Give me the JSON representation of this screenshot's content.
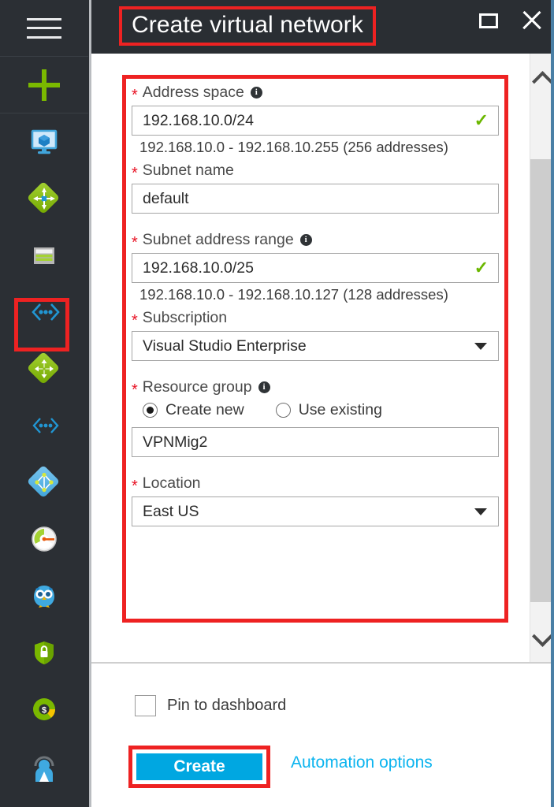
{
  "window": {
    "title": "Create virtual network",
    "restore_label": "restore-window",
    "close_label": "close-window"
  },
  "colors": {
    "accent_blue": "#00a7e1",
    "link_blue": "#0cb4ef",
    "annotation_red": "#ee2222",
    "required_red": "#e81123",
    "valid_green": "#6bb700",
    "sidebar_bg": "#2b2f34",
    "header_bg": "#2a2e33"
  },
  "sidebar": {
    "items": [
      {
        "name": "menu-hamburger",
        "icon": "hamburger-icon"
      },
      {
        "name": "create-resource",
        "icon": "plus-icon"
      },
      {
        "name": "dashboard",
        "icon": "dashboard-monitor-icon"
      },
      {
        "name": "all-resources",
        "icon": "all-resources-icon"
      },
      {
        "name": "resource-groups",
        "icon": "resource-groups-icon"
      },
      {
        "name": "virtual-networks-selected",
        "icon": "virtual-network-icon"
      },
      {
        "name": "load-balancers",
        "icon": "load-balancer-icon"
      },
      {
        "name": "virtual-networks",
        "icon": "virtual-network-icon"
      },
      {
        "name": "azure-active-directory",
        "icon": "azure-ad-icon"
      },
      {
        "name": "monitor",
        "icon": "monitor-gauge-icon"
      },
      {
        "name": "advisor",
        "icon": "owl-advisor-icon"
      },
      {
        "name": "security-center",
        "icon": "shield-lock-icon"
      },
      {
        "name": "cost-management",
        "icon": "cost-donut-icon"
      },
      {
        "name": "help-and-support",
        "icon": "help-person-icon"
      }
    ]
  },
  "form": {
    "address_space": {
      "label": "Address space",
      "required": true,
      "info": true,
      "value": "192.168.10.0/24",
      "valid": true,
      "valid_mark": "✓",
      "hint": "192.168.10.0 - 192.168.10.255 (256 addresses)"
    },
    "subnet_name": {
      "label": "Subnet name",
      "required": true,
      "info": false,
      "value": "default"
    },
    "subnet_address_range": {
      "label": "Subnet address range",
      "required": true,
      "info": true,
      "value": "192.168.10.0/25",
      "valid": true,
      "valid_mark": "✓",
      "hint": "192.168.10.0 - 192.168.10.127 (128 addresses)"
    },
    "subscription": {
      "label": "Subscription",
      "required": true,
      "info": false,
      "value": "Visual Studio Enterprise",
      "type": "dropdown"
    },
    "resource_group": {
      "label": "Resource group",
      "required": true,
      "info": true,
      "options": [
        {
          "label": "Create new",
          "selected": true
        },
        {
          "label": "Use existing",
          "selected": false
        }
      ],
      "value": "VPNMig2"
    },
    "location": {
      "label": "Location",
      "required": true,
      "info": false,
      "value": "East US",
      "type": "dropdown"
    }
  },
  "footer": {
    "pin_to_dashboard": {
      "label": "Pin to dashboard",
      "checked": false
    },
    "create_button": "Create",
    "automation_link": "Automation options"
  },
  "scrollbar": {
    "up_arrow": "scroll-up",
    "down_arrow": "scroll-down"
  }
}
